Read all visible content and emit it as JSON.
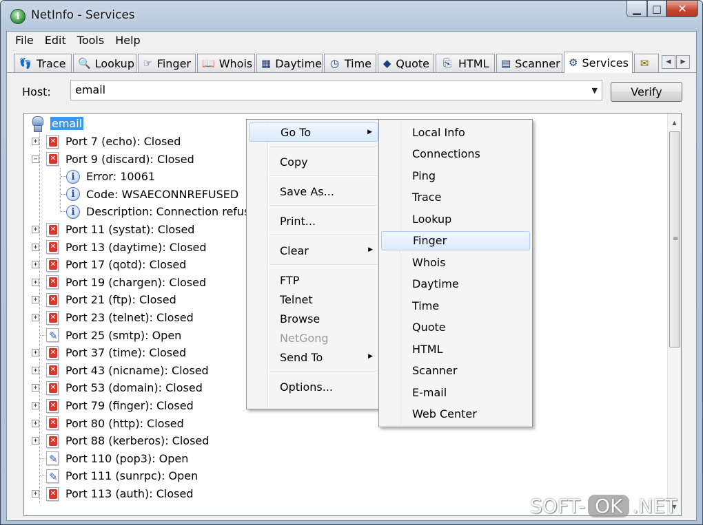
{
  "window": {
    "title": "NetInfo - Services"
  },
  "menubar": [
    "File",
    "Edit",
    "Tools",
    "Help"
  ],
  "tabs": [
    {
      "label": "Trace",
      "icon": "footprints-icon"
    },
    {
      "label": "Lookup",
      "icon": "magnifier-icon"
    },
    {
      "label": "Finger",
      "icon": "finger-icon"
    },
    {
      "label": "Whois",
      "icon": "book-icon"
    },
    {
      "label": "Daytime",
      "icon": "calendar-icon"
    },
    {
      "label": "Time",
      "icon": "clock-icon"
    },
    {
      "label": "Quote",
      "icon": "quote-book-icon"
    },
    {
      "label": "HTML",
      "icon": "html-page-icon"
    },
    {
      "label": "Scanner",
      "icon": "scanner-icon"
    },
    {
      "label": "Services",
      "icon": "services-icon",
      "active": true
    }
  ],
  "host": {
    "label": "Host:",
    "value": "email",
    "verify_label": "Verify"
  },
  "tree": {
    "root": "email",
    "nodes": [
      {
        "label": "Port 7 (echo): Closed",
        "status": "closed",
        "expander": "+"
      },
      {
        "label": "Port 9 (discard): Closed",
        "status": "closed",
        "expander": "-"
      },
      {
        "label": "Error: 10061",
        "status": "info",
        "child": true
      },
      {
        "label": "Code: WSAECONNREFUSED",
        "status": "info",
        "child": true
      },
      {
        "label": "Description: Connection refused",
        "status": "info",
        "child": true
      },
      {
        "label": "Port 11 (systat): Closed",
        "status": "closed",
        "expander": "+"
      },
      {
        "label": "Port 13 (daytime): Closed",
        "status": "closed",
        "expander": "+"
      },
      {
        "label": "Port 17 (qotd): Closed",
        "status": "closed",
        "expander": "+"
      },
      {
        "label": "Port 19 (chargen): Closed",
        "status": "closed",
        "expander": "+"
      },
      {
        "label": "Port 21 (ftp): Closed",
        "status": "closed",
        "expander": "+"
      },
      {
        "label": "Port 23 (telnet): Closed",
        "status": "closed",
        "expander": "+"
      },
      {
        "label": "Port 25 (smtp): Open",
        "status": "open"
      },
      {
        "label": "Port 37 (time): Closed",
        "status": "closed",
        "expander": "+"
      },
      {
        "label": "Port 43 (nicname): Closed",
        "status": "closed",
        "expander": "+"
      },
      {
        "label": "Port 53 (domain): Closed",
        "status": "closed",
        "expander": "+"
      },
      {
        "label": "Port 79 (finger): Closed",
        "status": "closed",
        "expander": "+"
      },
      {
        "label": "Port 80 (http): Closed",
        "status": "closed",
        "expander": "+"
      },
      {
        "label": "Port 88 (kerberos): Closed",
        "status": "closed",
        "expander": "+"
      },
      {
        "label": "Port 110 (pop3): Open",
        "status": "open"
      },
      {
        "label": "Port 111 (sunrpc): Open",
        "status": "open"
      },
      {
        "label": "Port 113 (auth): Closed",
        "status": "closed",
        "expander": "+"
      }
    ]
  },
  "context_menu": {
    "items": [
      {
        "label": "Go To",
        "submenu": true,
        "highlighted": true
      },
      {
        "separator": true
      },
      {
        "label": "Copy"
      },
      {
        "separator": true
      },
      {
        "label": "Save As..."
      },
      {
        "separator": true
      },
      {
        "label": "Print..."
      },
      {
        "separator": true
      },
      {
        "label": "Clear",
        "submenu": true
      },
      {
        "separator": true
      },
      {
        "label": "FTP"
      },
      {
        "label": "Telnet"
      },
      {
        "label": "Browse"
      },
      {
        "label": "NetGong",
        "disabled": true
      },
      {
        "label": "Send To",
        "submenu": true
      },
      {
        "separator": true
      },
      {
        "label": "Options..."
      }
    ]
  },
  "goto_submenu": {
    "items": [
      "Local Info",
      "Connections",
      "Ping",
      "Trace",
      "Lookup",
      "Finger",
      "Whois",
      "Daytime",
      "Time",
      "Quote",
      "HTML",
      "Scanner",
      "E-mail",
      "Web Center"
    ],
    "highlighted": "Finger"
  },
  "watermark": {
    "left": "SOFT-",
    "middle": "OK",
    "right": ".NET"
  },
  "colors": {
    "selection": "#3399ff",
    "closed_status": "#d6372b",
    "open_status": "#2a56b8"
  }
}
